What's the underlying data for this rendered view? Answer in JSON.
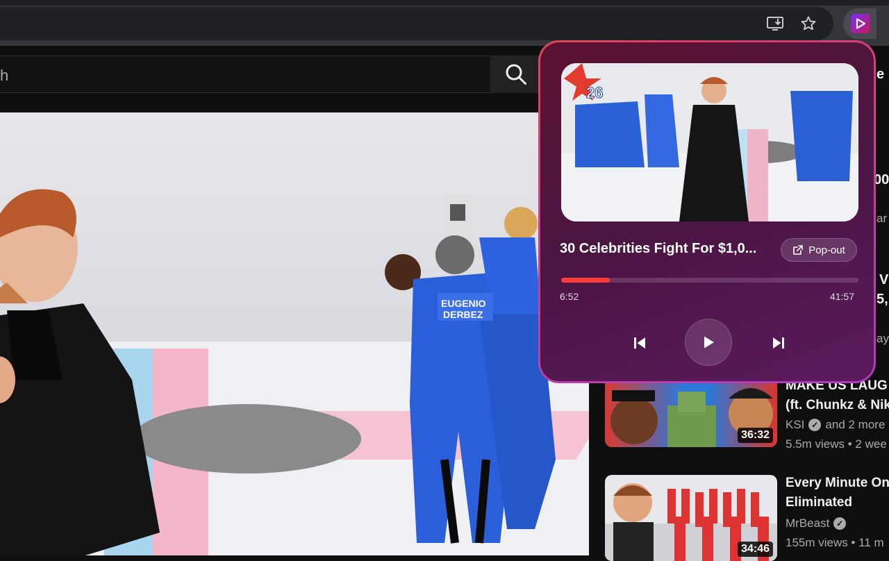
{
  "browser": {
    "icons": [
      "install-app-icon",
      "bookmark-star-icon",
      "extension-player-icon"
    ]
  },
  "youtube": {
    "search": {
      "visible_text": "h",
      "search_icon": "search-icon"
    }
  },
  "popup": {
    "title": "30 Celebrities Fight For $1,0...",
    "popout_label": "Pop-out",
    "current_time": "6:52",
    "total_time": "41:57",
    "progress": 0.164,
    "controls": [
      "previous-icon",
      "play-icon",
      "next-icon"
    ],
    "colors": {
      "accent": "#ff3b3b",
      "bg_start": "#5c1230",
      "bg_end": "#5a1a5e",
      "border": "#e0445a"
    },
    "thumb_badge": "26"
  },
  "recommendations": [
    {
      "title_lines": [
        "MAKE US LAUG",
        "(ft. Chunkz & Nik"
      ],
      "channel": "KSI",
      "channel_extra": "and 2 more",
      "meta": "5.5m views • 2 wee",
      "duration": "36:32"
    },
    {
      "title_lines": [
        "Every Minute On",
        "Eliminated"
      ],
      "channel": "MrBeast",
      "channel_extra": "",
      "meta": "155m views • 11 m",
      "duration": "34:46"
    }
  ],
  "right_clip": {
    "r1": "00",
    "r2": "ar",
    "r3": "V",
    "r4": "5,",
    "r5": "ay",
    "r6": "e"
  }
}
